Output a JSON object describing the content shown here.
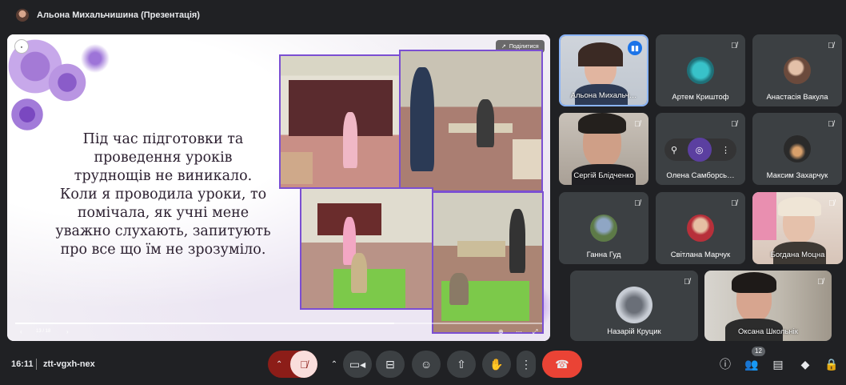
{
  "meeting": {
    "title": "Альона Михальчишина (Презентація)",
    "time": "16:11",
    "code": "ztt-vgxh-nex",
    "participant_count": "12"
  },
  "presentation": {
    "share_label": "Поділитися",
    "slide_text": "Під час підготовки та проведення уроків труднощів не виникало. Коли я проводила уроки, то помічала, як учні мене уважно слухають, запитують про все що їм не зрозуміло.",
    "page": "13 / 18",
    "progress": 0.72
  },
  "participants": [
    {
      "name": "Альона Михальч…"
    },
    {
      "name": "Артем Криштоф"
    },
    {
      "name": "Анастасія Вакула"
    },
    {
      "name": "Сергій Блідченко"
    },
    {
      "name": "Олена Самборсь…"
    },
    {
      "name": "Максим Захарчук"
    },
    {
      "name": "Ганна Гуд"
    },
    {
      "name": "Світлана Марчук"
    },
    {
      "name": "Богдана Моцна"
    },
    {
      "name": "Назарій Круцик"
    },
    {
      "name": "Оксана Школьнік"
    }
  ],
  "colors": {
    "accent": "#8ab4f8",
    "end_call": "#ea4335",
    "mic_off_bg": "#8c1d18",
    "slide_border": "#7b4fd2"
  }
}
